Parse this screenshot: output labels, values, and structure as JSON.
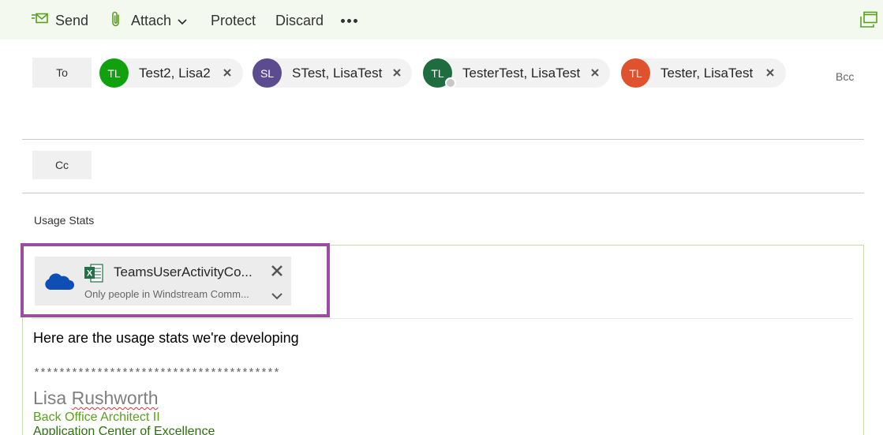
{
  "toolbar": {
    "send_label": "Send",
    "attach_label": "Attach",
    "protect_label": "Protect",
    "discard_label": "Discard",
    "accent_color": "#5aa01e"
  },
  "recipients": {
    "to_label": "To",
    "cc_label": "Cc",
    "bcc_label": "Bcc",
    "to": [
      {
        "initials": "TL",
        "name": "Test2, Lisa2",
        "color": "#12a10e"
      },
      {
        "initials": "SL",
        "name": "STest, LisaTest",
        "color": "#5c4b8e"
      },
      {
        "initials": "TL",
        "name": "TesterTest, LisaTest",
        "color": "#1f6d3e",
        "presence": "offline"
      },
      {
        "initials": "TL",
        "name": "Tester, LisaTest",
        "color": "#e0522e"
      }
    ]
  },
  "subject": "Usage Stats",
  "attachment": {
    "name": "TeamsUserActivityCo...",
    "permission": "Only people in Windstream Comm...",
    "icons": [
      "onedrive-cloud-icon",
      "excel-file-icon"
    ]
  },
  "message": {
    "body": "Here are the usage stats we're developing",
    "separator": "***************************************",
    "signature": {
      "first_name": "Lisa",
      "last_name": "Rushworth",
      "title": "Back Office Architect II",
      "department": "Application Center of Excellence"
    }
  }
}
